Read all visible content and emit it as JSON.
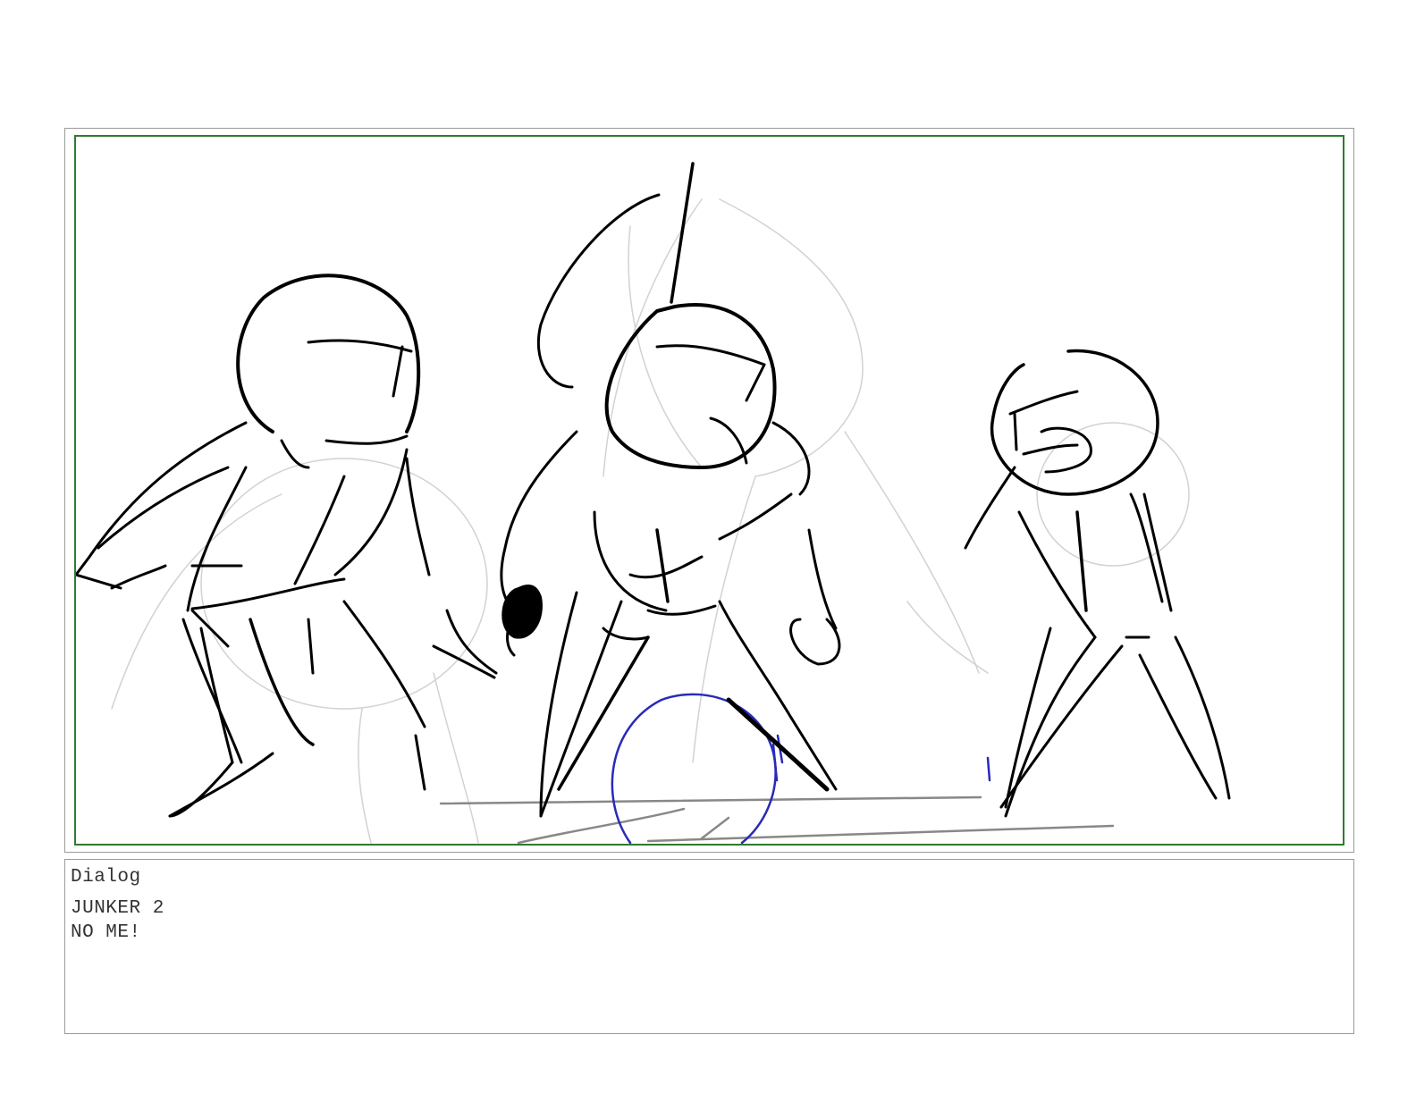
{
  "panel": {
    "frame_color": "#9a9a9a",
    "safe_area_color": "#2f7a2f",
    "sketch_ink": "#000000",
    "guide_ink": "#cccccc",
    "ground_ink": "#888888",
    "ball_ink": "#2a2ab8",
    "figures": [
      "left-figure",
      "center-figure",
      "right-figure"
    ]
  },
  "dialog": {
    "heading": "Dialog",
    "character": "JUNKER 2",
    "line": "NO ME!"
  }
}
